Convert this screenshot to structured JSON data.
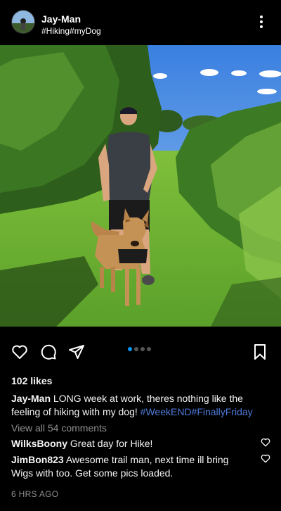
{
  "post": {
    "username": "Jay-Man",
    "subtitle": "#Hiking#myDog",
    "likes": "102 likes",
    "caption_user": "Jay-Man",
    "caption_text": " LONG week at work, theres nothing like the feeling of hiking with my dog! ",
    "caption_tags": "#WeekEND#FinallyFriday",
    "view_all": "View all 54 comments",
    "time": "6 HRS AGO"
  },
  "comments": [
    {
      "user": "WilksBoony",
      "text": " Great day for Hike!"
    },
    {
      "user": "JimBon823",
      "text": " Awesome trail man, next time ill bring Wigs with too. Get some pics loaded."
    }
  ],
  "carousel": {
    "count": 4,
    "active": 1
  },
  "icons": [
    "more-vertical-icon",
    "heart-icon",
    "comment-icon",
    "share-icon",
    "bookmark-icon"
  ],
  "colors": {
    "background": "#000000",
    "hashtag": "#4f7bd9",
    "muted": "#8e8e8e",
    "active_dot": "#0095f6"
  }
}
